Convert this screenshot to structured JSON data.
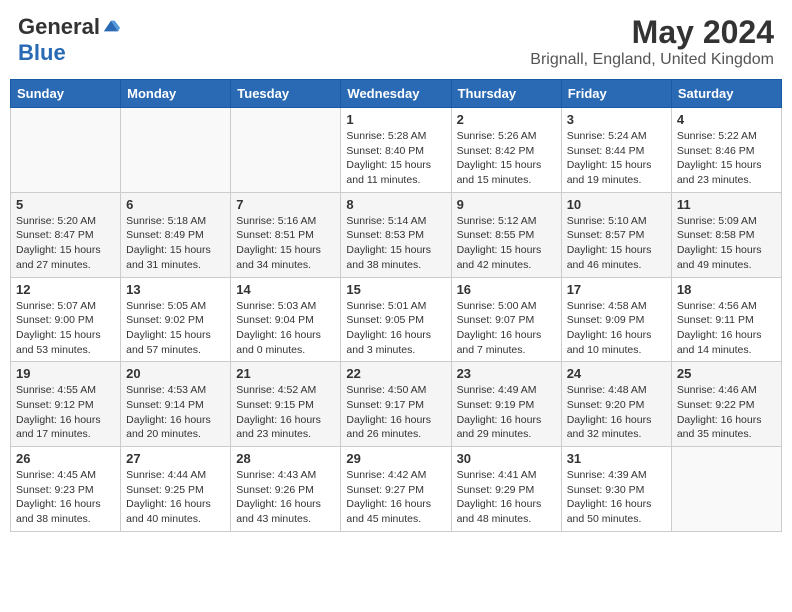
{
  "header": {
    "logo_general": "General",
    "logo_blue": "Blue",
    "month_year": "May 2024",
    "location": "Brignall, England, United Kingdom"
  },
  "days_of_week": [
    "Sunday",
    "Monday",
    "Tuesday",
    "Wednesday",
    "Thursday",
    "Friday",
    "Saturday"
  ],
  "weeks": [
    [
      {
        "day": "",
        "info": ""
      },
      {
        "day": "",
        "info": ""
      },
      {
        "day": "",
        "info": ""
      },
      {
        "day": "1",
        "info": "Sunrise: 5:28 AM\nSunset: 8:40 PM\nDaylight: 15 hours\nand 11 minutes."
      },
      {
        "day": "2",
        "info": "Sunrise: 5:26 AM\nSunset: 8:42 PM\nDaylight: 15 hours\nand 15 minutes."
      },
      {
        "day": "3",
        "info": "Sunrise: 5:24 AM\nSunset: 8:44 PM\nDaylight: 15 hours\nand 19 minutes."
      },
      {
        "day": "4",
        "info": "Sunrise: 5:22 AM\nSunset: 8:46 PM\nDaylight: 15 hours\nand 23 minutes."
      }
    ],
    [
      {
        "day": "5",
        "info": "Sunrise: 5:20 AM\nSunset: 8:47 PM\nDaylight: 15 hours\nand 27 minutes."
      },
      {
        "day": "6",
        "info": "Sunrise: 5:18 AM\nSunset: 8:49 PM\nDaylight: 15 hours\nand 31 minutes."
      },
      {
        "day": "7",
        "info": "Sunrise: 5:16 AM\nSunset: 8:51 PM\nDaylight: 15 hours\nand 34 minutes."
      },
      {
        "day": "8",
        "info": "Sunrise: 5:14 AM\nSunset: 8:53 PM\nDaylight: 15 hours\nand 38 minutes."
      },
      {
        "day": "9",
        "info": "Sunrise: 5:12 AM\nSunset: 8:55 PM\nDaylight: 15 hours\nand 42 minutes."
      },
      {
        "day": "10",
        "info": "Sunrise: 5:10 AM\nSunset: 8:57 PM\nDaylight: 15 hours\nand 46 minutes."
      },
      {
        "day": "11",
        "info": "Sunrise: 5:09 AM\nSunset: 8:58 PM\nDaylight: 15 hours\nand 49 minutes."
      }
    ],
    [
      {
        "day": "12",
        "info": "Sunrise: 5:07 AM\nSunset: 9:00 PM\nDaylight: 15 hours\nand 53 minutes."
      },
      {
        "day": "13",
        "info": "Sunrise: 5:05 AM\nSunset: 9:02 PM\nDaylight: 15 hours\nand 57 minutes."
      },
      {
        "day": "14",
        "info": "Sunrise: 5:03 AM\nSunset: 9:04 PM\nDaylight: 16 hours\nand 0 minutes."
      },
      {
        "day": "15",
        "info": "Sunrise: 5:01 AM\nSunset: 9:05 PM\nDaylight: 16 hours\nand 3 minutes."
      },
      {
        "day": "16",
        "info": "Sunrise: 5:00 AM\nSunset: 9:07 PM\nDaylight: 16 hours\nand 7 minutes."
      },
      {
        "day": "17",
        "info": "Sunrise: 4:58 AM\nSunset: 9:09 PM\nDaylight: 16 hours\nand 10 minutes."
      },
      {
        "day": "18",
        "info": "Sunrise: 4:56 AM\nSunset: 9:11 PM\nDaylight: 16 hours\nand 14 minutes."
      }
    ],
    [
      {
        "day": "19",
        "info": "Sunrise: 4:55 AM\nSunset: 9:12 PM\nDaylight: 16 hours\nand 17 minutes."
      },
      {
        "day": "20",
        "info": "Sunrise: 4:53 AM\nSunset: 9:14 PM\nDaylight: 16 hours\nand 20 minutes."
      },
      {
        "day": "21",
        "info": "Sunrise: 4:52 AM\nSunset: 9:15 PM\nDaylight: 16 hours\nand 23 minutes."
      },
      {
        "day": "22",
        "info": "Sunrise: 4:50 AM\nSunset: 9:17 PM\nDaylight: 16 hours\nand 26 minutes."
      },
      {
        "day": "23",
        "info": "Sunrise: 4:49 AM\nSunset: 9:19 PM\nDaylight: 16 hours\nand 29 minutes."
      },
      {
        "day": "24",
        "info": "Sunrise: 4:48 AM\nSunset: 9:20 PM\nDaylight: 16 hours\nand 32 minutes."
      },
      {
        "day": "25",
        "info": "Sunrise: 4:46 AM\nSunset: 9:22 PM\nDaylight: 16 hours\nand 35 minutes."
      }
    ],
    [
      {
        "day": "26",
        "info": "Sunrise: 4:45 AM\nSunset: 9:23 PM\nDaylight: 16 hours\nand 38 minutes."
      },
      {
        "day": "27",
        "info": "Sunrise: 4:44 AM\nSunset: 9:25 PM\nDaylight: 16 hours\nand 40 minutes."
      },
      {
        "day": "28",
        "info": "Sunrise: 4:43 AM\nSunset: 9:26 PM\nDaylight: 16 hours\nand 43 minutes."
      },
      {
        "day": "29",
        "info": "Sunrise: 4:42 AM\nSunset: 9:27 PM\nDaylight: 16 hours\nand 45 minutes."
      },
      {
        "day": "30",
        "info": "Sunrise: 4:41 AM\nSunset: 9:29 PM\nDaylight: 16 hours\nand 48 minutes."
      },
      {
        "day": "31",
        "info": "Sunrise: 4:39 AM\nSunset: 9:30 PM\nDaylight: 16 hours\nand 50 minutes."
      },
      {
        "day": "",
        "info": ""
      }
    ]
  ],
  "shaded_rows": [
    1,
    3
  ]
}
